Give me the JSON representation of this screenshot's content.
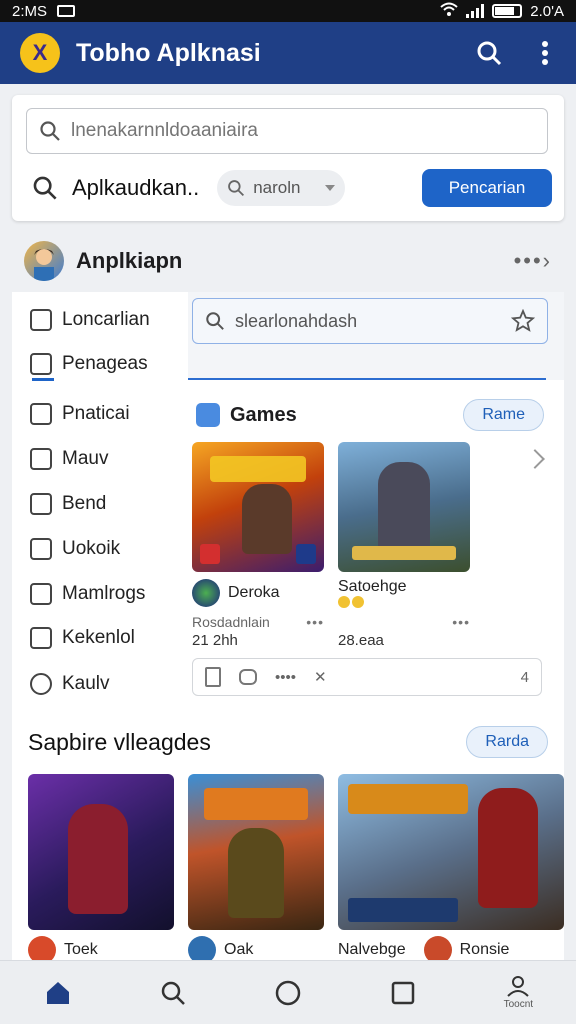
{
  "status_bar": {
    "time_left": "2:MS",
    "time_right": "2.0'A"
  },
  "app": {
    "title": "Tobho Aplknasi",
    "logo": "X"
  },
  "search": {
    "placeholder": "lnenakarnnldoaaniaira",
    "term": "Aplkaudkan..",
    "filter": "naroln",
    "button": "Pencarian"
  },
  "section": {
    "title": "Anplkiapn"
  },
  "sidebar": {
    "items": [
      {
        "label": "Loncarlian",
        "icon": "doc-icon"
      },
      {
        "label": "Penageas",
        "icon": "folder-icon"
      },
      {
        "label": "Pnaticai",
        "icon": "chart-icon"
      },
      {
        "label": "Mauv",
        "icon": "edit-icon"
      },
      {
        "label": "Bend",
        "icon": "home-icon"
      },
      {
        "label": "Uokoik",
        "icon": "grid-icon"
      },
      {
        "label": "Mamlrogs",
        "icon": "mail-icon"
      },
      {
        "label": "Kekenlol",
        "icon": "tag-icon"
      },
      {
        "label": "Kaulv",
        "icon": "user-icon"
      }
    ]
  },
  "inner_search": {
    "placeholder": "slearlonahdash"
  },
  "games": {
    "title": "Games",
    "button": "Rame",
    "items": [
      {
        "name": "Deroka",
        "sub": "Rosdadnlain",
        "size": "21 2hh",
        "dots": "•••"
      },
      {
        "name": "Satoehge",
        "sub": "",
        "size": "28.eaa",
        "dots": "•••"
      }
    ]
  },
  "action_bar": {
    "dots": "••••",
    "right": "4"
  },
  "section2": {
    "title": "Sapbire vlleagdes",
    "button": "Rarda",
    "items": [
      {
        "name": "Toek"
      },
      {
        "name": "Oak"
      },
      {
        "name": "Nalvebge"
      },
      {
        "name": "Ronsie"
      }
    ]
  },
  "bottom_nav": {
    "profile_label": "Toocnt"
  },
  "colors": {
    "appbar": "#1f3f86",
    "accent": "#1e64c8",
    "logo": "#f6c21a"
  }
}
